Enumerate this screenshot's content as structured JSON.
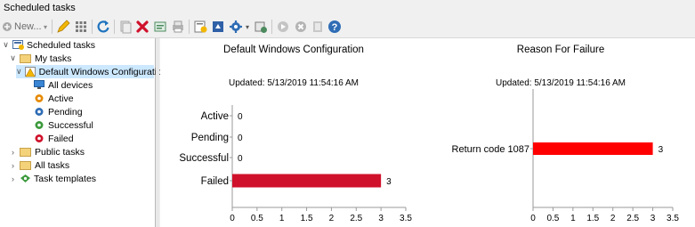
{
  "window": {
    "title": "Scheduled tasks"
  },
  "toolbar": {
    "new_label": "New...",
    "new_dropdown": "▾",
    "settings_dropdown": "▾"
  },
  "tree": {
    "root": "Scheduled tasks",
    "my_tasks": "My tasks",
    "config": "Default Windows Configuration",
    "children": [
      "All devices",
      "Active",
      "Pending",
      "Successful",
      "Failed"
    ],
    "public_tasks": "Public tasks",
    "all_tasks": "All tasks",
    "task_templates": "Task templates"
  },
  "chart_data": [
    {
      "type": "bar",
      "orientation": "horizontal",
      "title": "Default Windows Configuration",
      "subtitle": "Updated: 5/13/2019 11:54:16 AM",
      "categories": [
        "Active",
        "Pending",
        "Successful",
        "Failed"
      ],
      "values": [
        0,
        0,
        0,
        3
      ],
      "value_labels": [
        "0",
        "0",
        "0",
        "3"
      ],
      "xlim": [
        0,
        3.5
      ],
      "xticks": [
        "0",
        "0.5",
        "1",
        "1.5",
        "2",
        "2.5",
        "3",
        "3.5"
      ],
      "bar_color": "#d0112b",
      "grid": false
    },
    {
      "type": "bar",
      "orientation": "horizontal",
      "title": "Reason For Failure",
      "subtitle": "Updated: 5/13/2019 11:54:16 AM",
      "categories": [
        "Return code 1087"
      ],
      "values": [
        3
      ],
      "value_labels": [
        "3"
      ],
      "xlim": [
        0,
        3.5
      ],
      "xticks": [
        "0",
        "0.5",
        "1",
        "1.5",
        "2",
        "2.5",
        "3",
        "3.5"
      ],
      "bar_color": "#ff0000",
      "grid": false
    }
  ]
}
